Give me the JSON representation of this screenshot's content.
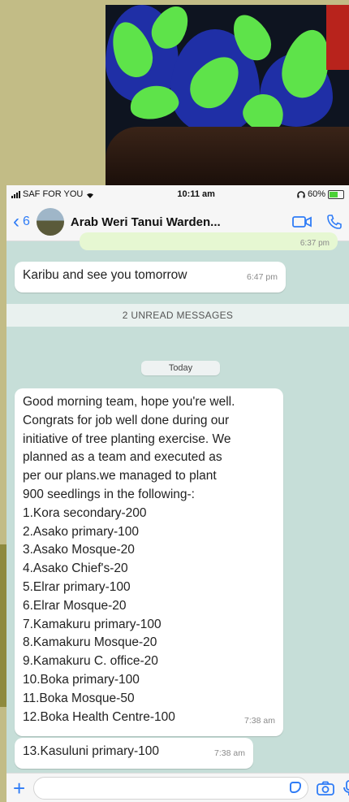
{
  "status_bar": {
    "carrier": "SAF FOR YOU",
    "time": "10:11 am",
    "battery": "60%"
  },
  "header": {
    "back_count": "6",
    "title": "Arab Weri Tanui Warden..."
  },
  "messages": {
    "prev_time": "6:37 pm",
    "m1_text": "Karibu and see you tomorrow",
    "m1_time": "6:47 pm",
    "unread_label": "2 UNREAD MESSAGES",
    "date_label": "Today",
    "m2_lines": [
      "Good morning team, hope you're well.",
      "Congrats for job well done during our",
      "initiative of tree planting exercise. We",
      "planned as a team and executed as",
      "per our plans.we managed to plant",
      "900 seedlings in the following-:",
      "1.Kora secondary-200",
      "2.Asako primary-100",
      "3.Asako Mosque-20",
      "4.Asako Chief's-20",
      "5.Elrar primary-100",
      "6.Elrar Mosque-20",
      "7.Kamakuru primary-100",
      "8.Kamakuru Mosque-20",
      "9.Kamakuru C. office-20",
      "10.Boka primary-100",
      "11.Boka Mosque-50",
      "12.Boka Health Centre-100"
    ],
    "m2_time": "7:38 am",
    "m3_text": "13.Kasuluni primary-100",
    "m3_time": "7:38 am"
  },
  "icons": {
    "signal": "signal-bars-icon",
    "wifi": "wifi-icon",
    "headphones": "headphones-icon",
    "battery": "battery-icon",
    "back": "chevron-left-icon",
    "video": "video-call-icon",
    "phone": "phone-call-icon",
    "attach": "plus-icon",
    "sticker": "sticker-icon",
    "camera": "camera-icon",
    "mic": "microphone-icon"
  },
  "colors": {
    "accent": "#2f7cf6",
    "chat_background": "#c6ded8",
    "outer_background": "#c2bc86"
  }
}
